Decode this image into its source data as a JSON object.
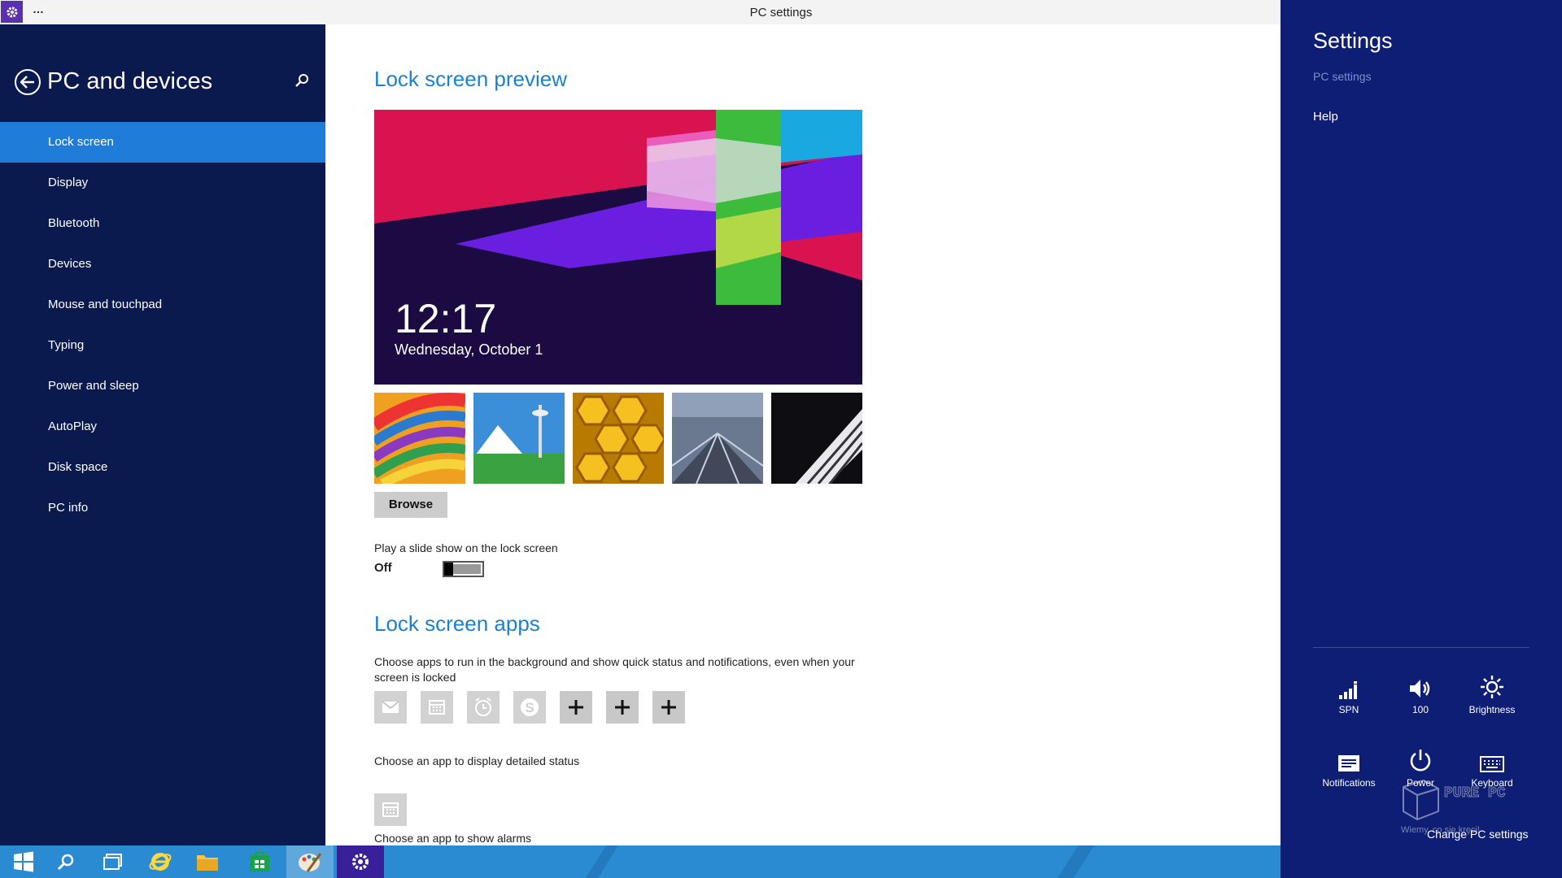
{
  "window": {
    "title": "PC settings",
    "menu_glyph": "…",
    "app_icon": "gear-icon"
  },
  "nav": {
    "title": "PC and devices",
    "back_icon": "back-arrow-icon",
    "search_icon": "search-icon",
    "items": [
      {
        "label": "Lock screen",
        "active": true
      },
      {
        "label": "Display"
      },
      {
        "label": "Bluetooth"
      },
      {
        "label": "Devices"
      },
      {
        "label": "Mouse and touchpad"
      },
      {
        "label": "Typing"
      },
      {
        "label": "Power and sleep"
      },
      {
        "label": "AutoPlay"
      },
      {
        "label": "Disk space"
      },
      {
        "label": "PC info"
      }
    ]
  },
  "content": {
    "preview_title": "Lock screen preview",
    "lock_time": "12:17",
    "lock_date": "Wednesday, October 1",
    "browse_label": "Browse",
    "slideshow_label": "Play a slide show on the lock screen",
    "slideshow_state": "Off",
    "apps_title": "Lock screen apps",
    "apps_desc": "Choose apps to run in the background and show quick status and notifications, even when your screen is locked",
    "lock_apps": [
      "mail-icon",
      "calendar-icon",
      "alarm-icon",
      "skype-icon",
      "add-icon",
      "add-icon",
      "add-icon"
    ],
    "detailed_status_label": "Choose an app to display detailed status",
    "detailed_status_app": "calendar-icon",
    "alarms_label": "Choose an app to show alarms"
  },
  "taskbar": {
    "items": [
      "start-icon",
      "search-icon",
      "task-view-icon",
      "internet-explorer-icon",
      "file-explorer-icon",
      "store-icon",
      "paint-icon",
      "pc-settings-icon"
    ]
  },
  "charms": {
    "title": "Settings",
    "subtitle": "PC settings",
    "help": "Help",
    "quick": [
      {
        "label": "SPN",
        "icon": "network-signal-icon"
      },
      {
        "label": "100",
        "icon": "volume-icon"
      },
      {
        "label": "Brightness",
        "icon": "brightness-icon"
      },
      {
        "label": "Notifications",
        "icon": "notifications-icon"
      },
      {
        "label": "Power",
        "icon": "power-icon"
      },
      {
        "label": "Keyboard",
        "icon": "keyboard-icon"
      }
    ],
    "change_pc_settings": "Change PC settings"
  },
  "watermark": {
    "brand": "PURE PC",
    "tagline": "Wiemy, co się kręci!"
  },
  "colors": {
    "nav_bg": "#0a1a4f",
    "nav_active": "#1f7cd8",
    "accent_text": "#1a80d0",
    "charms_bg": "#0e1e74",
    "taskbar": "#2a8bd3"
  }
}
